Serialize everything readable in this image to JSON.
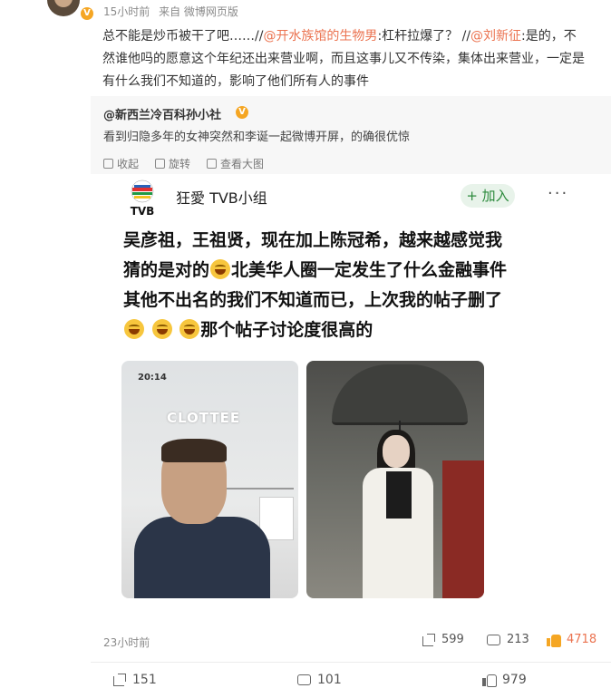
{
  "post": {
    "meta_time": "15小时前",
    "meta_from": "来自 微博网页版",
    "text_lead": "总不能是炒币被干了吧……//",
    "mention1": "@开水族馆的生物男",
    "text_mid1": ":杠杆拉爆了？ //",
    "mention2": "@刘新征",
    "text_tail": ":是的，不然谁他吗的愿意这个年纪还出来营业啊，而且这事儿又不传染，集体出来营业，一定是有什么我们不知道的，影响了他们所有人的事件"
  },
  "quoted": {
    "author": "@新西兰冷百科孙小社",
    "text": "看到归隐多年的女神突然和李诞一起微博开屏，的确很优惊",
    "actions": [
      {
        "icon": "collapse-icon",
        "label": "收起"
      },
      {
        "icon": "rotate-icon",
        "label": "旋转"
      },
      {
        "icon": "view-image-icon",
        "label": "查看大图"
      }
    ]
  },
  "card": {
    "logo_text": "TVB",
    "group_name": "狂愛 TVB小组",
    "join_label": "+ 加入",
    "more": "···",
    "line1": "吴彦祖，王祖贤，现在加上陈冠希，越来越感觉我",
    "line2a": "猜的是对的",
    "line2b": "北美华人圈一定发生了什么金融事件",
    "line3": "其他不出名的我们不知道而已，上次我的帖子删了",
    "line4": "那个帖子讨论度很高的",
    "photo1_time": "20:14",
    "photo1_brand": "CLOTTEE"
  },
  "card_footer": {
    "time": "23小时前",
    "share": "599",
    "comment": "213",
    "like": "4718"
  },
  "footer": {
    "share": "151",
    "comment": "101",
    "like": "979"
  },
  "colors": {
    "accent": "#eb7350",
    "verified": "#f5a623",
    "join_green": "#2c8a3c"
  }
}
